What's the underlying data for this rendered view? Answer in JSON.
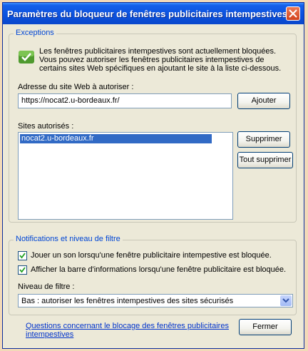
{
  "window": {
    "title": "Paramètres du bloqueur de fenêtres publicitaires intempestives"
  },
  "exceptions": {
    "legend": "Exceptions",
    "description": "Les fenêtres publicitaires intempestives sont actuellement bloquées. Vous pouvez autoriser les fenêtres publicitaires intempestives de certains sites Web spécifiques en ajoutant le site à la liste ci-dessous.",
    "address_label": "Adresse du site Web à autoriser :",
    "address_value": "https://nocat2.u-bordeaux.fr/",
    "add_button": "Ajouter",
    "allowed_label": "Sites autorisés :",
    "allowed_sites": [
      "nocat2.u-bordeaux.fr"
    ],
    "remove_button": "Supprimer",
    "remove_all_button": "Tout supprimer"
  },
  "notifications": {
    "legend": "Notifications et niveau de filtre",
    "sound_option": {
      "label": "Jouer un son lorsqu'une fenêtre publicitaire intempestive est bloquée.",
      "checked": true
    },
    "infobar_option": {
      "label": "Afficher la barre d'informations lorsqu'une fenêtre publicitaire est bloquée.",
      "checked": true
    },
    "filter_label": "Niveau de filtre :",
    "filter_value": "Bas : autoriser les fenêtres intempestives des sites sécurisés"
  },
  "footer": {
    "help_link": "Questions concernant le blocage des fenêtres publicitaires intempestives",
    "close_button": "Fermer"
  },
  "icons": {
    "close": "close-icon",
    "info": "info-shield-icon",
    "check": "check-icon",
    "dropdown": "chevron-down-icon"
  }
}
